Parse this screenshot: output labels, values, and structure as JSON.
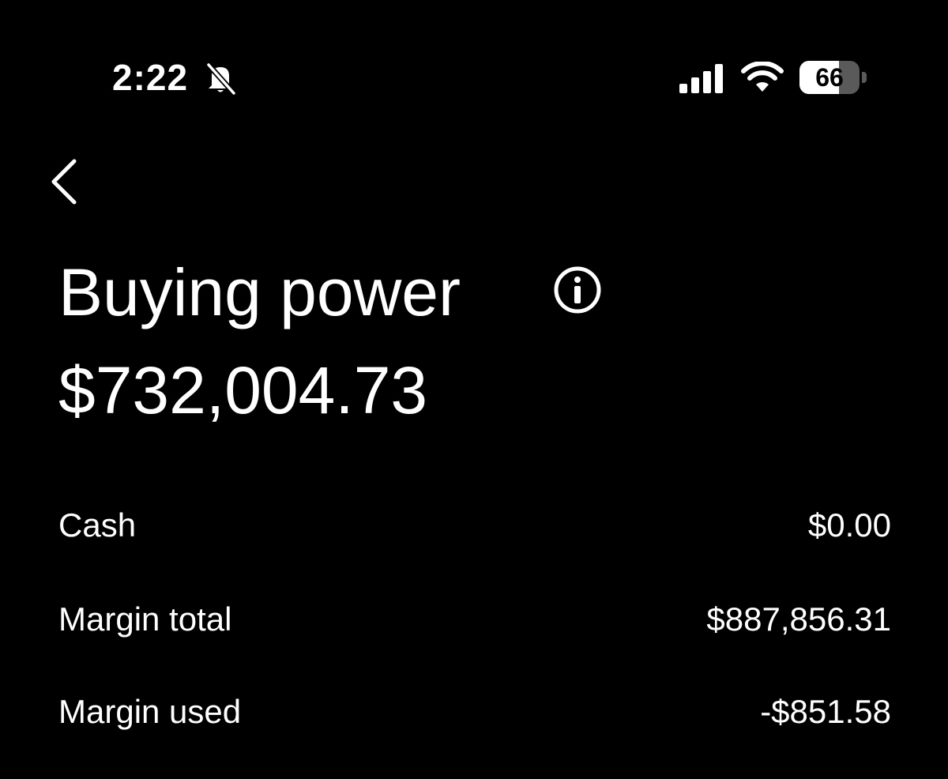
{
  "status_bar": {
    "time": "2:22",
    "battery_level": "66",
    "battery_fraction": 0.66,
    "icons": [
      "bell-slash-icon",
      "cellular-signal-icon",
      "wifi-icon",
      "battery-icon"
    ]
  },
  "nav": {
    "back_icon": "chevron-left-icon"
  },
  "header": {
    "title": "Buying power",
    "info_icon": "info-icon",
    "amount": "$732,004.73"
  },
  "details": {
    "rows": [
      {
        "label": "Cash",
        "value": "$0.00"
      },
      {
        "label": "Margin total",
        "value": "$887,856.31"
      },
      {
        "label": "Margin used",
        "value": "-$851.58"
      }
    ]
  },
  "colors": {
    "background": "#000000",
    "text": "#ffffff",
    "battery_empty": "#5a5a5a"
  }
}
